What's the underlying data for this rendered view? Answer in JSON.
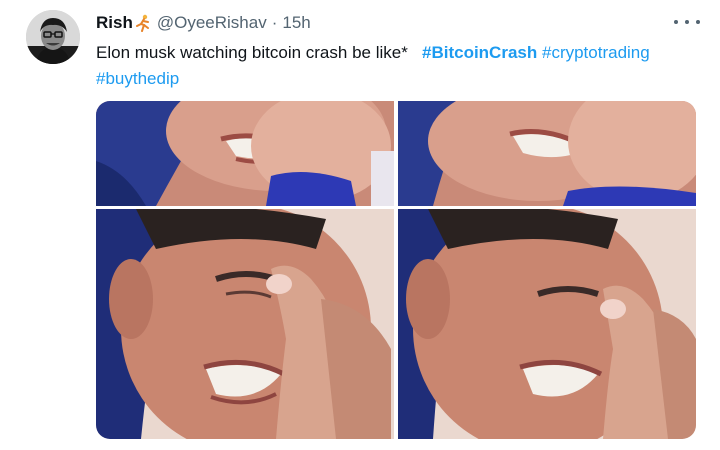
{
  "tweet": {
    "display_name": "Rish",
    "name_emoji": "person-running-emoji",
    "handle": "@OyeeRishav",
    "separator": "·",
    "time": "15h",
    "more_icon": "more-icon",
    "text": "Elon musk watching bitcoin crash be like*",
    "hashtags": [
      "#BitcoinCrash",
      "#cryptotrading",
      "#buythedip"
    ],
    "media": {
      "layout": "2x2 grid",
      "images": [
        {
          "name": "meme-image-top-left"
        },
        {
          "name": "meme-image-top-right"
        },
        {
          "name": "meme-image-bottom-left"
        },
        {
          "name": "meme-image-bottom-right"
        }
      ]
    },
    "colors": {
      "link": "#1d9bf0",
      "secondary_text": "#536471",
      "primary_text": "#0f1419"
    }
  }
}
